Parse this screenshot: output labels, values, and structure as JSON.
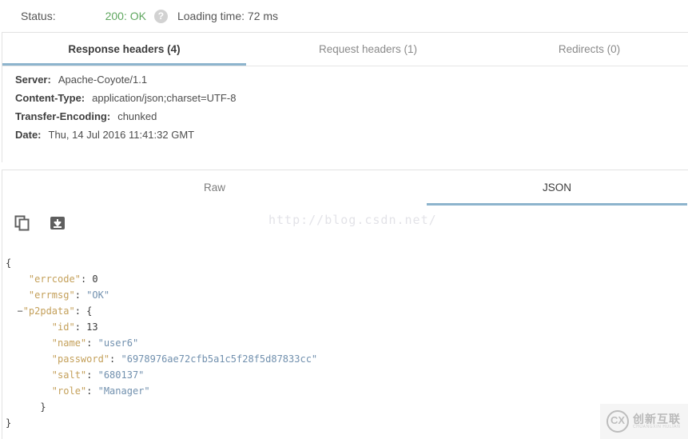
{
  "status_bar": {
    "label": "Status:",
    "code": "200: OK",
    "help_icon": "question-mark-icon",
    "loading_time": "Loading time: 72 ms",
    "code_color": "#5fa75f"
  },
  "header_tabs": [
    {
      "label": "Response headers (4)",
      "active": true
    },
    {
      "label": "Request headers (1)",
      "active": false
    },
    {
      "label": "Redirects (0)",
      "active": false
    }
  ],
  "response_headers": [
    {
      "key": "Server:",
      "value": "Apache-Coyote/1.1"
    },
    {
      "key": "Content-Type:",
      "value": "application/json;charset=UTF-8"
    },
    {
      "key": "Transfer-Encoding:",
      "value": "chunked"
    },
    {
      "key": "Date:",
      "value": "Thu, 14 Jul 2016 11:41:32 GMT"
    }
  ],
  "body_tabs": [
    {
      "label": "Raw",
      "active": false
    },
    {
      "label": "JSON",
      "active": true
    }
  ],
  "tools": [
    {
      "icon": "copy-icon",
      "name": "copy-button"
    },
    {
      "icon": "download-icon",
      "name": "download-button"
    }
  ],
  "watermark": {
    "url": "http://blog.csdn.net/",
    "logo_mark": "CX",
    "logo_cn": "创新互联",
    "logo_en": "CHUANGXIN HULIAN"
  },
  "json_body": {
    "open_brace": "{",
    "close_brace": "}",
    "collapser": "−",
    "lines": [
      {
        "indent": 1,
        "key": "\"errcode\"",
        "sep": ": ",
        "value": "0",
        "type": "num"
      },
      {
        "indent": 1,
        "key": "\"errmsg\"",
        "sep": ": ",
        "value": "\"OK\"",
        "type": "str"
      },
      {
        "indent": 1,
        "key": "\"p2pdata\"",
        "sep": ": ",
        "value": "{",
        "type": "punc",
        "collapsible": true
      },
      {
        "indent": 3,
        "key": "\"id\"",
        "sep": ": ",
        "value": "13",
        "type": "num"
      },
      {
        "indent": 3,
        "key": "\"name\"",
        "sep": ": ",
        "value": "\"user6\"",
        "type": "str"
      },
      {
        "indent": 3,
        "key": "\"password\"",
        "sep": ": ",
        "value": "\"6978976ae72cfb5a1c5f28f5d87833cc\"",
        "type": "str"
      },
      {
        "indent": 3,
        "key": "\"salt\"",
        "sep": ": ",
        "value": "\"680137\"",
        "type": "str"
      },
      {
        "indent": 3,
        "key": "\"role\"",
        "sep": ": ",
        "value": "\"Manager\"",
        "type": "str"
      },
      {
        "indent": 2,
        "key": "",
        "sep": "",
        "value": "}",
        "type": "punc"
      }
    ],
    "colors": {
      "key": "#c4a05a",
      "string": "#7190ae",
      "number": "#3a3a3a"
    }
  },
  "accent_color": "#8db4cd"
}
